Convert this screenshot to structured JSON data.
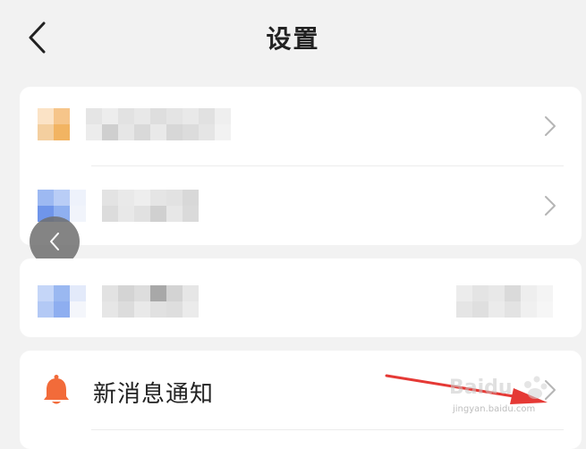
{
  "header": {
    "title": "设置",
    "back_icon": "chevron-left-icon"
  },
  "settings": {
    "new_message_notification_label": "新消息通知",
    "notification_icon": "bell-icon"
  },
  "watermark": {
    "text": "jingyan.baidu.com"
  },
  "colors": {
    "background": "#f2f2f2",
    "card": "#ffffff",
    "bell": "#f26b3a",
    "annotation_arrow": "#e53935",
    "chevron": "#b5b5b5"
  }
}
